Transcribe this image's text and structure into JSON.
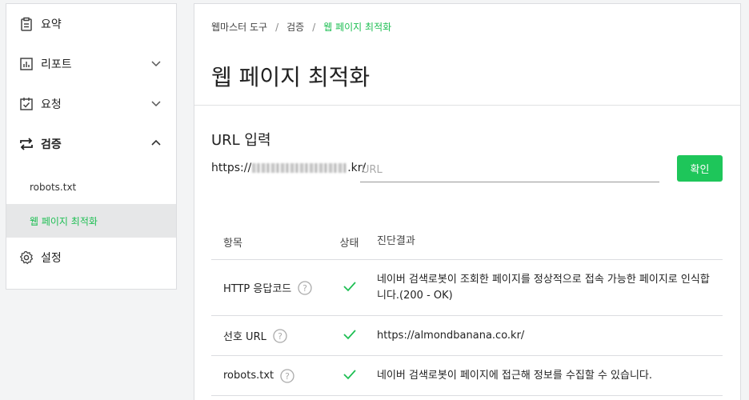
{
  "sidebar": {
    "items": [
      {
        "label": "요약",
        "icon": "clipboard-icon"
      },
      {
        "label": "리포트",
        "icon": "bar-chart-icon"
      },
      {
        "label": "요청",
        "icon": "checklist-icon"
      },
      {
        "label": "검증",
        "icon": "repeat-arrows-icon"
      },
      {
        "label": "설정",
        "icon": "gear-icon"
      }
    ],
    "sub_items": [
      {
        "label": "robots.txt"
      },
      {
        "label": "웹 페이지 최적화"
      }
    ]
  },
  "breadcrumb": {
    "items": [
      "웹마스터 도구",
      "검증",
      "웹 페이지 최적화"
    ]
  },
  "page": {
    "title": "웹 페이지 최적화"
  },
  "url_section": {
    "title": "URL 입력",
    "prefix_start": "https://",
    "prefix_end": ".kr/",
    "placeholder": "URL",
    "button_label": "확인"
  },
  "table": {
    "headers": [
      "항목",
      "상태",
      "진단결과"
    ],
    "rows": [
      {
        "item": "HTTP 응답코드",
        "status": "ok",
        "result": "네이버 검색로봇이 조회한 페이지를 정상적으로 접속 가능한 페이지로 인식합니다.(200 - OK)"
      },
      {
        "item": "선호 URL",
        "status": "ok",
        "result": "https://almondbanana.co.kr/"
      },
      {
        "item": "robots.txt",
        "status": "ok",
        "result": "네이버 검색로봇이 페이지에 접근해 정보를 수집할 수 있습니다."
      }
    ]
  },
  "colors": {
    "accent": "#1fbf54",
    "button": "#1ec65a"
  }
}
